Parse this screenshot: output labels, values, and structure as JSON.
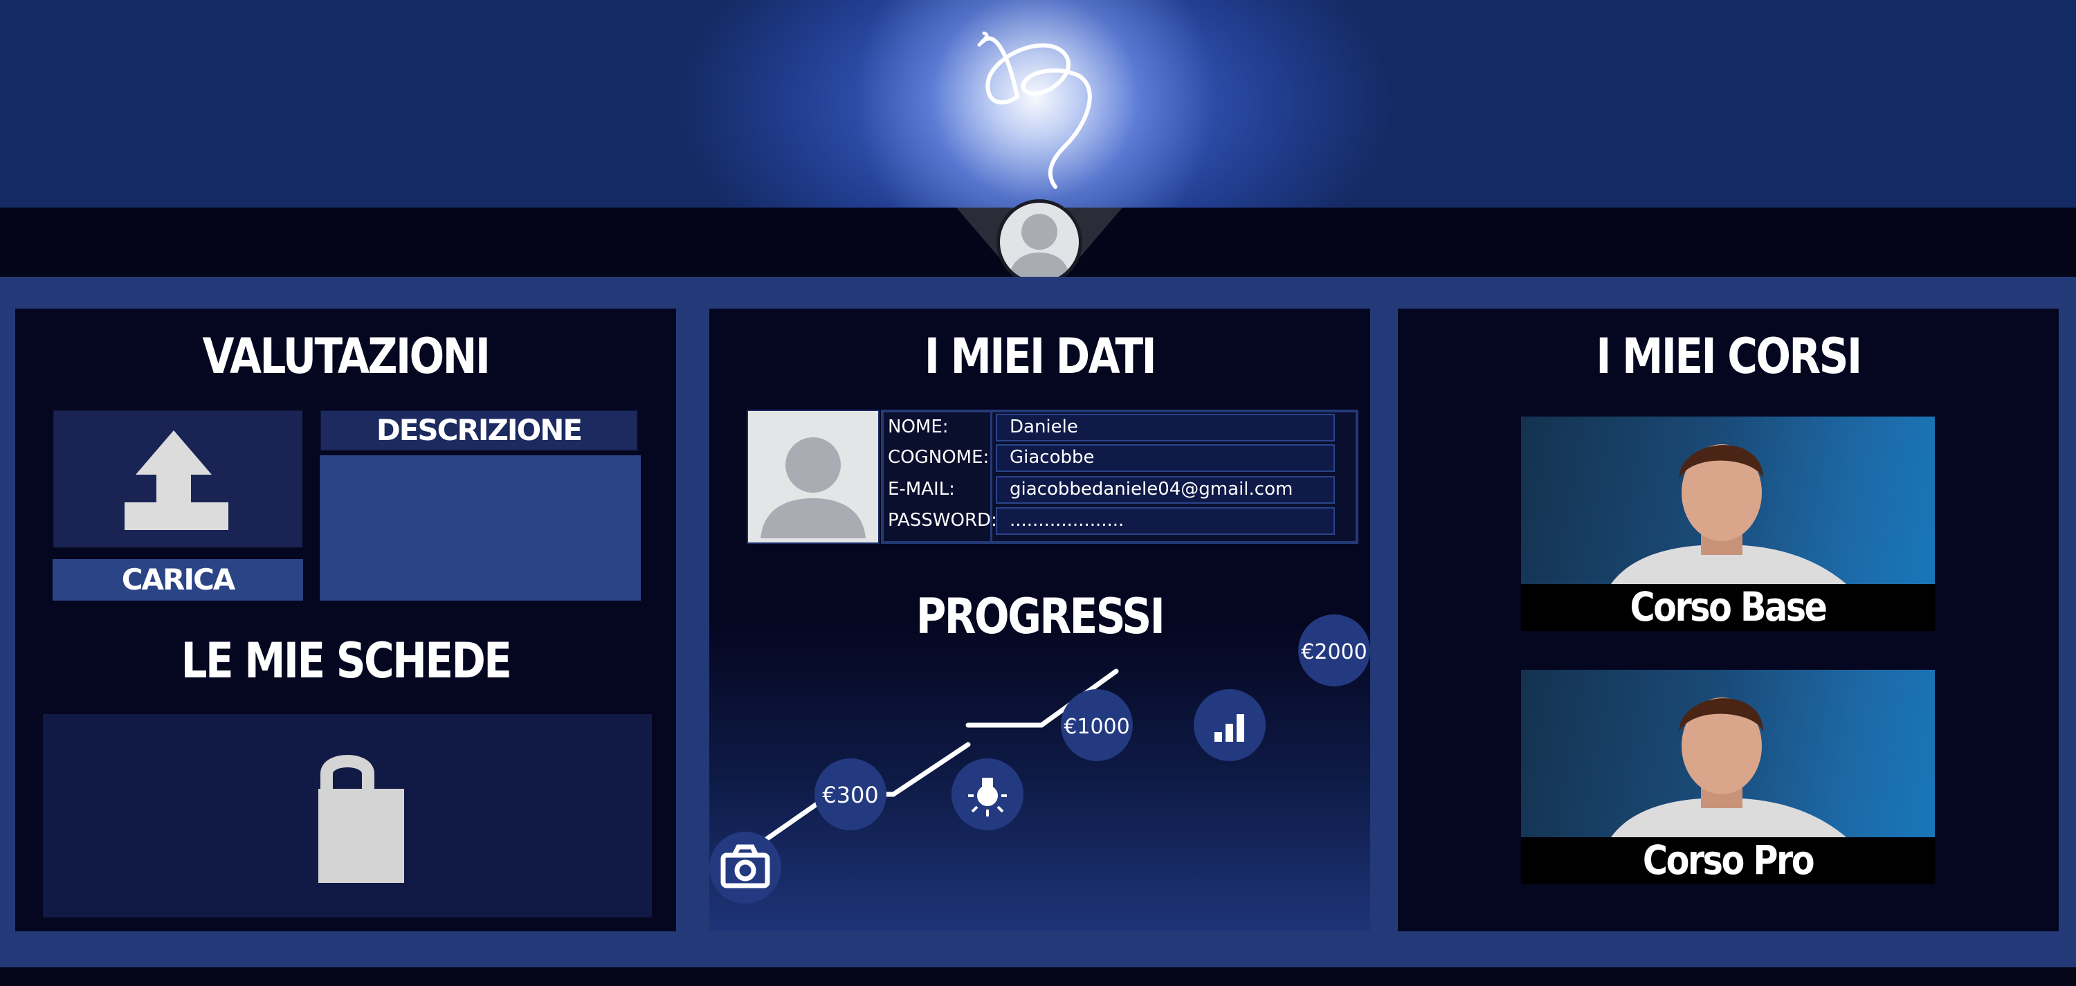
{
  "header": {
    "logo": "DB handwritten logo",
    "avatar_icon": "user-avatar-icon"
  },
  "valutazioni": {
    "title": "VALUTAZIONI",
    "upload_icon": "upload-icon",
    "upload_button": "CARICA",
    "description_label": "DESCRIZIONE",
    "description_value": ""
  },
  "schede": {
    "title": "LE MIE SCHEDE",
    "lock_icon": "lock-icon"
  },
  "dati": {
    "title": "I MIEI DATI",
    "photo_icon": "user-placeholder-icon",
    "fields": [
      {
        "label": "NOME:",
        "value": "Daniele"
      },
      {
        "label": "COGNOME:",
        "value": "Giacobbe"
      },
      {
        "label": "E-MAIL:",
        "value": "giacobbedaniele04@gmail.com"
      },
      {
        "label": "PASSWORD:",
        "value": "...................."
      }
    ]
  },
  "progressi": {
    "title": "PROGRESSI",
    "steps": [
      {
        "icon": "camera-icon",
        "label": ""
      },
      {
        "icon": "",
        "label": "€300"
      },
      {
        "icon": "lightbulb-icon",
        "label": ""
      },
      {
        "icon": "",
        "label": "€1000"
      },
      {
        "icon": "bar-chart-icon",
        "label": ""
      },
      {
        "icon": "",
        "label": "€2000"
      }
    ]
  },
  "corsi": {
    "title": "I MIEI CORSI",
    "courses": [
      {
        "label": "Corso Base"
      },
      {
        "label": "Corso Pro"
      }
    ]
  },
  "colors": {
    "background": "#243a78",
    "panel": "#050620",
    "accent": "#2a4486",
    "node": "#233a80"
  }
}
